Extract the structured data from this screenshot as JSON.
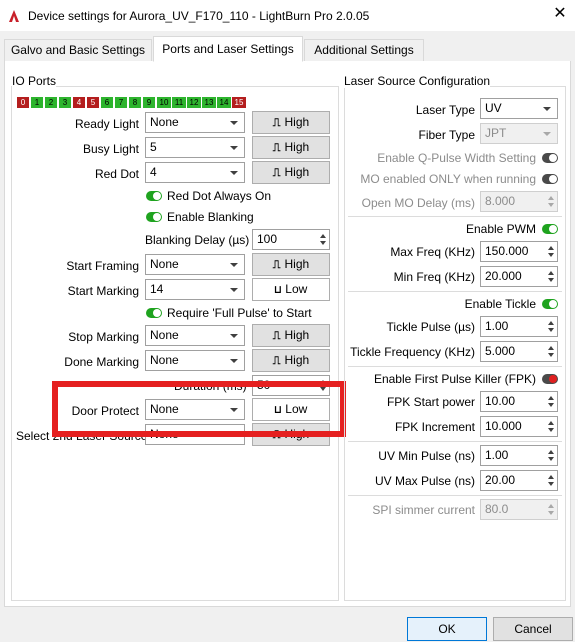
{
  "window": {
    "title": "Device settings for Aurora_UV_F170_110 - LightBurn Pro 2.0.05",
    "close_glyph": "✕"
  },
  "tabs": [
    {
      "label": "Galvo and Basic Settings",
      "active": false
    },
    {
      "label": "Ports and Laser Settings",
      "active": true
    },
    {
      "label": "Additional Settings",
      "active": false
    }
  ],
  "io": {
    "title": "IO Ports",
    "ports": [
      {
        "n": "0",
        "state": "red"
      },
      {
        "n": "1",
        "state": "green"
      },
      {
        "n": "2",
        "state": "green"
      },
      {
        "n": "3",
        "state": "green"
      },
      {
        "n": "4",
        "state": "red"
      },
      {
        "n": "5",
        "state": "red"
      },
      {
        "n": "6",
        "state": "green"
      },
      {
        "n": "7",
        "state": "green"
      },
      {
        "n": "8",
        "state": "green"
      },
      {
        "n": "9",
        "state": "green"
      },
      {
        "n": "10",
        "state": "green"
      },
      {
        "n": "11",
        "state": "green"
      },
      {
        "n": "12",
        "state": "green"
      },
      {
        "n": "13",
        "state": "green"
      },
      {
        "n": "14",
        "state": "green"
      },
      {
        "n": "15",
        "state": "red"
      }
    ],
    "ready_light": {
      "label": "Ready Light",
      "value": "None",
      "pulse": "High"
    },
    "busy_light": {
      "label": "Busy Light",
      "value": "5",
      "pulse": "High"
    },
    "red_dot": {
      "label": "Red Dot",
      "value": "4",
      "pulse": "High"
    },
    "red_dot_always_on": "Red Dot Always On",
    "enable_blanking": "Enable Blanking",
    "blanking_delay": {
      "label": "Blanking Delay (µs)",
      "value": "100"
    },
    "start_framing": {
      "label": "Start Framing",
      "value": "None",
      "pulse": "High"
    },
    "start_marking": {
      "label": "Start Marking",
      "value": "14",
      "pulse": "Low"
    },
    "require_full_pulse": "Require 'Full Pulse' to Start",
    "stop_marking": {
      "label": "Stop Marking",
      "value": "None",
      "pulse": "High"
    },
    "done_marking": {
      "label": "Done Marking",
      "value": "None",
      "pulse": "High"
    },
    "duration": {
      "label": "Duration (ms)",
      "value": "50"
    },
    "door_protect": {
      "label": "Door Protect",
      "value": "None",
      "pulse": "Low"
    },
    "second_laser": {
      "label": "Select 2nd Laser Source",
      "value": "None",
      "pulse": "High"
    }
  },
  "laser": {
    "title": "Laser Source Configuration",
    "laser_type": {
      "label": "Laser Type",
      "value": "UV"
    },
    "fiber_type": {
      "label": "Fiber Type",
      "value": "JPT"
    },
    "q_pulse": "Enable Q-Pulse Width Setting",
    "mo_enabled": "MO enabled ONLY when running",
    "open_mo_delay": {
      "label": "Open MO Delay (ms)",
      "value": "8.000"
    },
    "enable_pwm": "Enable PWM",
    "max_freq": {
      "label": "Max Freq (KHz)",
      "value": "150.000"
    },
    "min_freq": {
      "label": "Min Freq (KHz)",
      "value": "20.000"
    },
    "enable_tickle": "Enable Tickle",
    "tickle_pulse": {
      "label": "Tickle Pulse (µs)",
      "value": "1.00"
    },
    "tickle_freq": {
      "label": "Tickle Frequency (KHz)",
      "value": "5.000"
    },
    "fpk": "Enable First Pulse Killer (FPK)",
    "fpk_start": {
      "label": "FPK Start power",
      "value": "10.00"
    },
    "fpk_inc": {
      "label": "FPK Increment",
      "value": "10.000"
    },
    "uv_min": {
      "label": "UV Min Pulse (ns)",
      "value": "1.00"
    },
    "uv_max": {
      "label": "UV Max Pulse (ns)",
      "value": "20.00"
    },
    "spi": {
      "label": "SPI simmer current",
      "value": "80.0"
    }
  },
  "footer": {
    "ok": "OK",
    "cancel": "Cancel"
  },
  "colors": {
    "toggle_on": "#1fa31f",
    "highlight": "#e52020",
    "port_on": "#2db42d",
    "port_off": "#b41e1e"
  }
}
